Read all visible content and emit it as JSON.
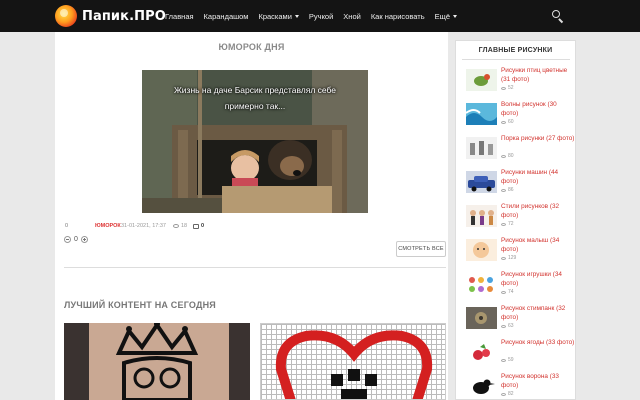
{
  "logo": {
    "text": "Папик.ПРО"
  },
  "nav": {
    "items": [
      {
        "label": "Главная",
        "caret": false
      },
      {
        "label": "Карандашом",
        "caret": false
      },
      {
        "label": "Красками",
        "caret": true
      },
      {
        "label": "Ручкой",
        "caret": false
      },
      {
        "label": "Хной",
        "caret": false
      },
      {
        "label": "Как нарисовать",
        "caret": false
      },
      {
        "label": "Ещё",
        "caret": true
      }
    ]
  },
  "humor": {
    "title": "ЮМОРОК ДНЯ",
    "caption": "Жизнь на даче Барсик представлял себе примерно так...",
    "meta": {
      "count": "0",
      "category": "ЮМОРОК",
      "date": "31-01-2021, 17:37",
      "views": "18",
      "comments": "0"
    },
    "rating": "0",
    "see_all": "СМОТРЕТЬ ВСЕ"
  },
  "best": {
    "title": "ЛУЧШИЙ КОНТЕНТ НА СЕГОДНЯ"
  },
  "sidebar": {
    "title": "ГЛАВНЫЕ РИСУНКИ",
    "items": [
      {
        "title": "Рисунки птиц цветные (31 фото)",
        "views": "52"
      },
      {
        "title": "Волны рисунок (30 фото)",
        "views": "60"
      },
      {
        "title": "Порка рисунки (27 фото)",
        "views": "80"
      },
      {
        "title": "Рисунки машин (44 фото)",
        "views": "86"
      },
      {
        "title": "Стили рисунков (32 фото)",
        "views": "72"
      },
      {
        "title": "Рисунок малыш (34 фото)",
        "views": "129"
      },
      {
        "title": "Рисунок игрушки (34 фото)",
        "views": "74"
      },
      {
        "title": "Рисунок стимпанк (32 фото)",
        "views": "63"
      },
      {
        "title": "Рисунок ягоды (33 фото)",
        "views": "59"
      },
      {
        "title": "Рисунок ворона (33 фото)",
        "views": "82"
      }
    ]
  }
}
